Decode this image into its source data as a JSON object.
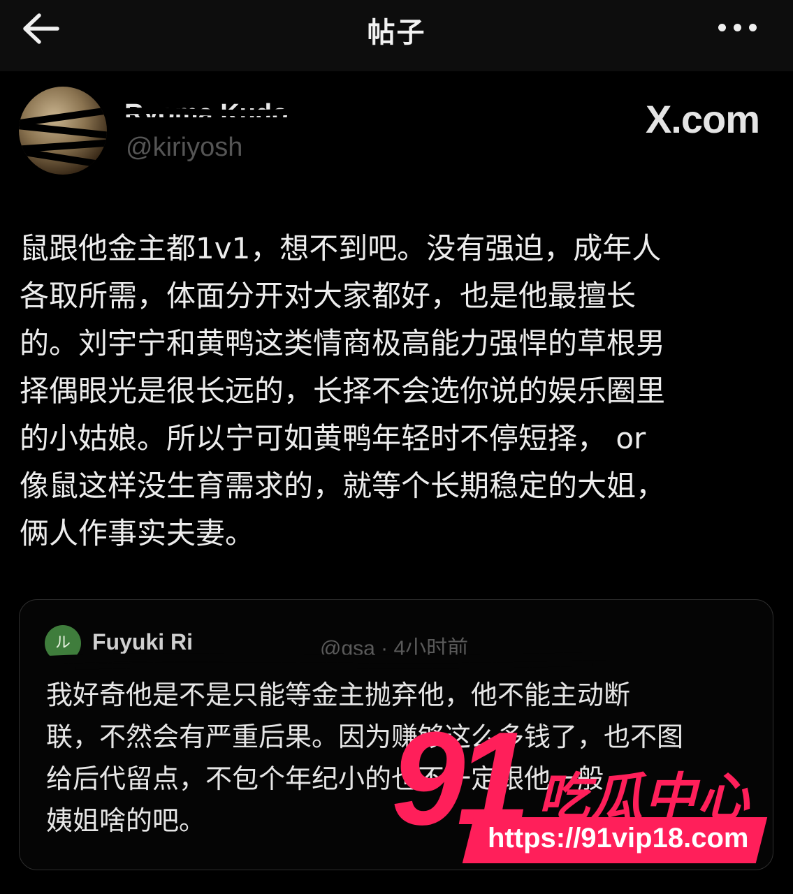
{
  "header": {
    "title": "帖子"
  },
  "author": {
    "name": "Ryoma Kudo",
    "handle": "@kiriyosh"
  },
  "source_brand": "X.com",
  "post": {
    "text": "鼠跟他金主都1v1，想不到吧。没有强迫，成年人\n各取所需，体面分开对大家都好，也是他最擅长\n的。刘宇宁和黄鸭这类情商极高能力强悍的草根男\n择偶眼光是很长远的，长择不会选你说的娱乐圈里\n的小姑娘。所以宁可如黄鸭年轻时不停短择， or\n像鼠这样没生育需求的，就等个长期稳定的大姐，\n俩人作事实夫妻。"
  },
  "quote": {
    "avatar_text": "ル",
    "name": "Fuyuki Ri",
    "handle": "@gsa · 4小时前",
    "text": "我好奇他是不是只能等金主抛弃他，他不能主动断\n联，不然会有严重后果。因为赚够这么多钱了，也不图\n给后代留点，不包个年纪小的也不一定跟他一般\n姨姐啥的吧。"
  },
  "watermark": {
    "number": "91",
    "brand_cn": "吃瓜中心",
    "url": "https://91vip18.com",
    "color": "#ff1f5a"
  }
}
